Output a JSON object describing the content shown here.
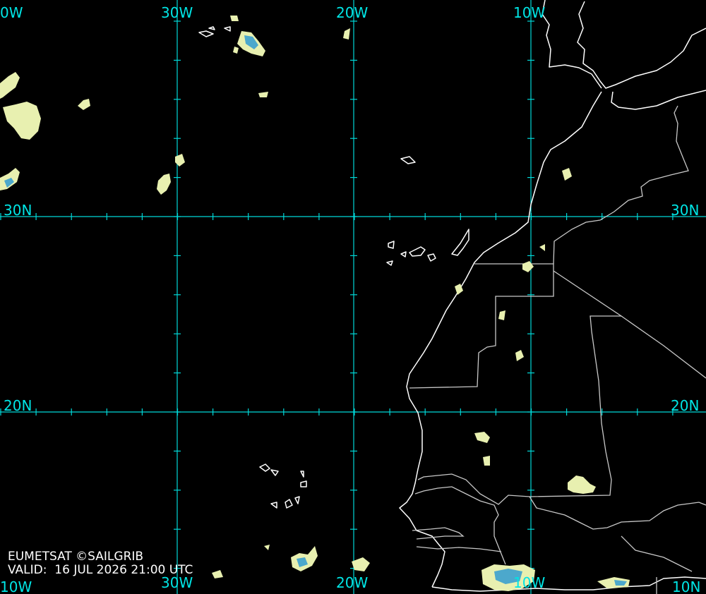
{
  "map": {
    "projection": "lat-lon grid",
    "grid_color": "#00d8d8",
    "coast_color": "#ffffff",
    "border_color": "#c8c8c8",
    "cloud_colors": [
      "#f4f7b8",
      "#4aa6c8"
    ],
    "background": "#000000"
  },
  "labels": {
    "lon_40w_top": "0W",
    "lon_30w_top": "30W",
    "lon_20w_top": "20W",
    "lon_10w_top": "10W",
    "lat_30n_left": "30N",
    "lat_30n_right": "30N",
    "lat_20n_left": "20N",
    "lat_20n_right": "20N",
    "lon_40w_bottom": "10W",
    "lon_30w_bottom": "30W",
    "lon_20w_bottom": "20W",
    "lon_10w_bottom": "10W",
    "lon_0_bottom": "10N"
  },
  "credit": {
    "source": "EUMETSAT ©SAILGRIB",
    "valid_label": "VALID:",
    "valid_time": "16 JUL 2026 21:00 UTC"
  }
}
